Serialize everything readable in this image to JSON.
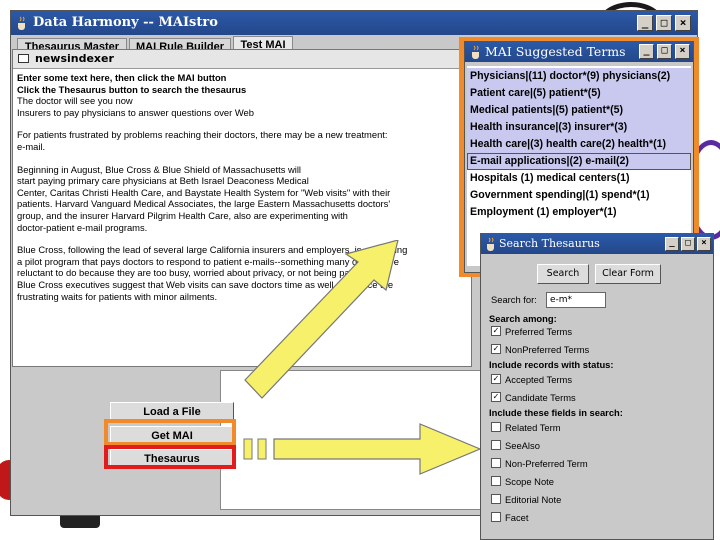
{
  "colors": {
    "orange": "#f08a2a",
    "red": "#e21c1c",
    "yellow": "#f7f06a",
    "title_blue": "#2b59a8",
    "selection": "#c9c9f0"
  },
  "main_window": {
    "title": "Data Harmony -- MAIstro",
    "tabs": [
      "Thesaurus Master",
      "MAI Rule Builder",
      "Test MAI"
    ],
    "active_tab": "Test MAI"
  },
  "doc_window": {
    "title": "newsindexer",
    "instructions": [
      "Enter some text here, then click the MAI button",
      "Click the Thesaurus button to search the thesaurus"
    ],
    "paragraphs": [
      "The doctor will see you now\nInsurers to pay physicians to answer questions over Web",
      "For patients frustrated by problems reaching their doctors, there may be a new treatment:\ne-mail.",
      "Beginning in August, Blue Cross & Blue Shield of Massachusetts will\nstart paying primary care physicians at Beth Israel Deaconess Medical\nCenter, Caritas Christi Health Care, and Baystate Health System for \"Web visits\" with their\npatients. Harvard Vanguard Medical Associates, the large Eastern Massachusetts doctors'\ngroup, and the insurer Harvard Pilgrim Health Care, also are experimenting with\ndoctor-patient e-mail programs.",
      "Blue Cross, following the lead of several large California insurers and employers, is expanding\na pilot program that pays doctors to respond to patient e-mails--something many doctors are\nreluctant to do because they are too busy, worried about privacy, or not being paid for it.\nBlue Cross executives suggest that Web visits can save doctors time as well as reduce the\nfrustrating waits for patients with minor ailments."
    ]
  },
  "buttons": {
    "load_file": "Load a File",
    "get_mai": "Get MAI",
    "thesaurus": "Thesaurus"
  },
  "mai_panel": {
    "title": "MAI Suggested Terms",
    "terms": [
      "Physicians|(11) doctor*(9) physicians(2)",
      "Patient care|(5) patient*(5)",
      "Medical patients|(5) patient*(5)",
      "Health insurance|(3) insurer*(3)",
      "Health care|(3) health care(2) health*(1)",
      "E-mail applications|(2) e-mail(2)",
      "Hospitals (1) medical centers(1)",
      "Government spending|(1) spend*(1)",
      "Employment (1) employer*(1)"
    ]
  },
  "search_window": {
    "title": "Search Thesaurus",
    "search_button": "Search",
    "clear_button": "Clear Form",
    "search_for_label": "Search for:",
    "search_value": "e-m*",
    "search_among_label": "Search among:",
    "among": [
      {
        "label": "Preferred Terms",
        "checked": true
      },
      {
        "label": "NonPreferred Terms",
        "checked": true
      }
    ],
    "status_label": "Include records with status:",
    "status": [
      {
        "label": "Accepted Terms",
        "checked": true
      },
      {
        "label": "Candidate Terms",
        "checked": true
      }
    ],
    "fields_label": "Include these fields in search:",
    "fields": [
      {
        "label": "Related Term",
        "checked": false
      },
      {
        "label": "SeeAlso",
        "checked": false
      },
      {
        "label": "Non-Preferred Term",
        "checked": false
      },
      {
        "label": "Scope Note",
        "checked": false
      },
      {
        "label": "Editorial Note",
        "checked": false
      },
      {
        "label": "Facet",
        "checked": false
      }
    ]
  },
  "icons": {
    "app": "java-cup-icon",
    "minimize": "minimize-icon",
    "maximize": "maximize-icon",
    "close": "close-icon",
    "arrows": "yellow-arrow-icon"
  }
}
